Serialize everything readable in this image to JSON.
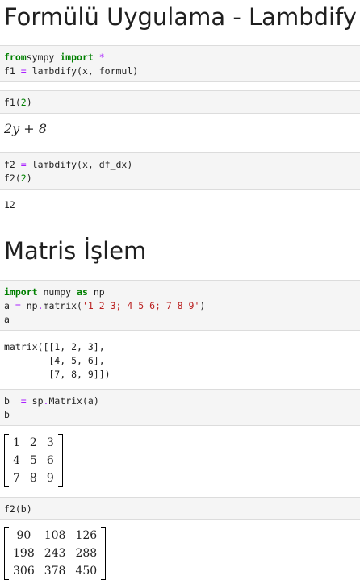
{
  "headings": {
    "h1": "Formülü Uygulama - Lambdify",
    "h2": "Matris İşlem"
  },
  "cells": [
    {
      "input": [
        [
          [
            "kw",
            "from"
          ],
          [
            "",
            "sympy "
          ],
          [
            "kw",
            "import"
          ],
          [
            "",
            ""
          ],
          [
            "op",
            " *"
          ]
        ],
        [
          [
            "",
            "f1 "
          ],
          [
            "op",
            "="
          ],
          [
            "",
            "",
            " "
          ],
          [
            "",
            "lambdify(x, formul)"
          ]
        ]
      ]
    },
    {
      "input": [
        [
          [
            "",
            "f1("
          ],
          [
            "num",
            "2"
          ],
          [
            "",
            ")"
          ]
        ]
      ],
      "output": "2y + 8"
    },
    {
      "input": [
        [
          [
            "",
            "f2 "
          ],
          [
            "op",
            "="
          ],
          [
            "",
            "",
            " "
          ],
          [
            "",
            "lambdify(x, df_dx)"
          ]
        ],
        [
          [
            "",
            "f2("
          ],
          [
            "num",
            "2"
          ],
          [
            "",
            ")"
          ]
        ]
      ],
      "output": "12"
    },
    {
      "input": [
        [
          [
            "kw",
            "import"
          ],
          [
            "",
            "",
            " "
          ],
          [
            "",
            "numpy "
          ],
          [
            "kw",
            "as"
          ],
          [
            "",
            "",
            " "
          ],
          [
            "",
            "np"
          ]
        ],
        [
          [
            "",
            "a "
          ],
          [
            "op",
            "="
          ],
          [
            "",
            "",
            ""
          ],
          [
            "",
            "",
            " np"
          ],
          [
            "op",
            "."
          ],
          [
            "",
            "matrix("
          ],
          [
            "str",
            "'1 2 3; 4 5 6; 7 8 9'"
          ],
          [
            "",
            ")"
          ]
        ],
        [
          [
            "",
            "a"
          ]
        ]
      ],
      "output": "matrix([[1, 2, 3],\n        [4, 5, 6],\n        [7, 8, 9]])"
    },
    {
      "input": [
        [
          [
            "",
            "b  "
          ],
          [
            "op",
            "="
          ],
          [
            "",
            "",
            " sp"
          ],
          [
            "op",
            "."
          ],
          [
            "",
            "Matrix(a)"
          ]
        ],
        [
          [
            "",
            "b"
          ]
        ]
      ],
      "output_matrix": [
        [
          "1",
          "2",
          "3"
        ],
        [
          "4",
          "5",
          "6"
        ],
        [
          "7",
          "8",
          "9"
        ]
      ]
    },
    {
      "input": [
        [
          [
            "",
            "f2(b)"
          ]
        ]
      ],
      "output_matrix": [
        [
          "90",
          "108",
          "126"
        ],
        [
          "198",
          "243",
          "288"
        ],
        [
          "306",
          "378",
          "450"
        ]
      ]
    }
  ]
}
